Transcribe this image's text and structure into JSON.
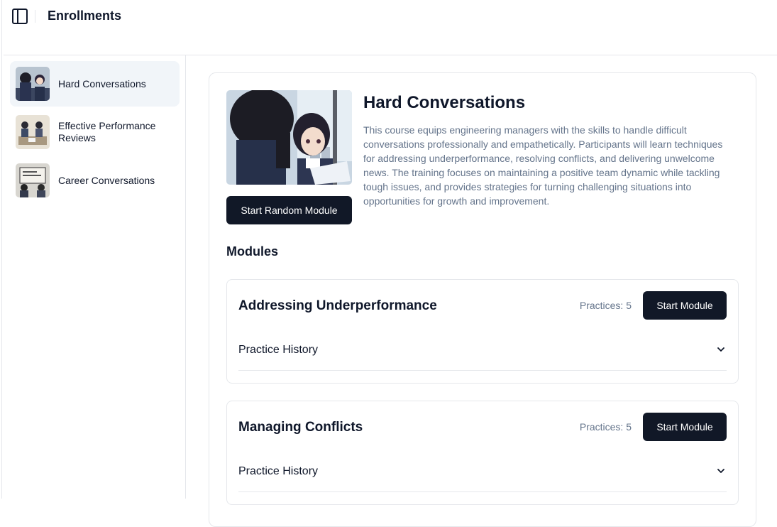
{
  "header": {
    "title": "Enrollments",
    "toggle_icon": "sidebar-toggle-icon"
  },
  "sidebar": {
    "items": [
      {
        "label": "Hard Conversations",
        "active": true
      },
      {
        "label": "Effective Performance Reviews",
        "active": false
      },
      {
        "label": "Career Conversations",
        "active": false
      }
    ]
  },
  "course": {
    "title": "Hard Conversations",
    "description": "This course equips engineering managers with the skills to handle difficult conversations professionally and empathetically. Participants will learn techniques for addressing underperformance, resolving conflicts, and delivering unwelcome news. The training focuses on maintaining a positive team dynamic while tackling tough issues, and provides strategies for turning challenging situations into opportunities for growth and improvement.",
    "start_random_label": "Start Random Module"
  },
  "modules_heading": "Modules",
  "modules": [
    {
      "title": "Addressing Underperformance",
      "practices": "Practices: 5",
      "start_label": "Start Module",
      "history_label": "Practice History"
    },
    {
      "title": "Managing Conflicts",
      "practices": "Practices: 5",
      "start_label": "Start Module",
      "history_label": "Practice History"
    }
  ],
  "colors": {
    "primary": "#111827",
    "muted": "#64748b",
    "border": "#e5e7eb",
    "active_bg": "#f1f5f9"
  }
}
